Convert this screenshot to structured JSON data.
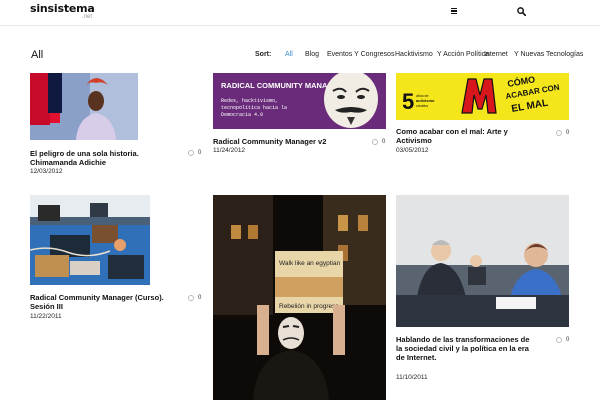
{
  "site": {
    "logo_main": "sinsistema",
    "logo_sub": ".net"
  },
  "section_title": "All",
  "sort": {
    "label": "Sort:",
    "filters": [
      "All",
      "Blog",
      "Eventos Y Congresos",
      "Hacktivismo",
      "Y Acción Política",
      "Internet",
      "Y Nuevas Tecnologías"
    ]
  },
  "posts": [
    {
      "title": "El peligro de una sola historia. Chimamanda Adichie",
      "date": "12/03/2012",
      "comments": "0"
    },
    {
      "title": "Radical Community Manager v2",
      "date": "11/24/2012",
      "comments": "0",
      "thumb_heading": "RADICAL COMMUNITY MANAGER",
      "thumb_text": [
        "Redes, hacktivismo,",
        "tecnopolítica hacia la",
        "Democracia 4.0"
      ]
    },
    {
      "title": "Como acabar con el mal: Arte y Activismo",
      "date": "03/05/2012",
      "comments": "0",
      "thumb_number": "5",
      "thumb_small": [
        "años de",
        "activismo",
        "creativo"
      ],
      "thumb_headline": [
        "CÓMO",
        "ACABAR CON",
        "EL MAL"
      ]
    },
    {
      "title": "Radical Community Manager (Curso). Sesión III",
      "date": "11/22/2011",
      "comments": "0"
    },
    {
      "title": "",
      "date": "",
      "comments": "",
      "sign_line1": "Walk like an egyptian",
      "sign_line2": "Rebelión in progress"
    },
    {
      "title": "Hablando de las transformaciones de la sociedad civil y la política en la era de Internet.",
      "date": "11/10/2011",
      "comments": "0"
    }
  ],
  "colors": {
    "accent": "#3a8fd6",
    "yellow": "#f5e61c",
    "purple": "#6a2c7a"
  }
}
